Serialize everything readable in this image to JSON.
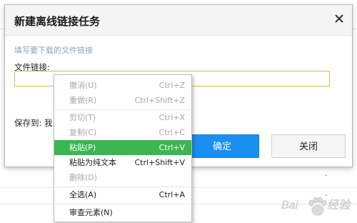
{
  "dialog": {
    "title": "新建离线链接任务",
    "close_icon": "close-icon",
    "hint": "填写要下载的文件链接",
    "link_label": "文件链接:",
    "link_value": "",
    "save_label": "保存到: 我",
    "confirm_label": "确定",
    "close_label": "关闭"
  },
  "context_menu": {
    "items": [
      {
        "label": "撤消(U)",
        "shortcut": "Ctrl+Z",
        "state": "disabled"
      },
      {
        "label": "重做(R)",
        "shortcut": "Ctrl+Shift+Z",
        "state": "disabled"
      },
      {
        "label": "剪切(T)",
        "shortcut": "Ctrl+X",
        "state": "disabled"
      },
      {
        "label": "复制(C)",
        "shortcut": "Ctrl+C",
        "state": "disabled"
      },
      {
        "label": "粘贴(P)",
        "shortcut": "Ctrl+V",
        "state": "highlighted"
      },
      {
        "label": "粘贴为纯文本",
        "shortcut": "Ctrl+Shift+V",
        "state": "enabled"
      },
      {
        "label": "删除(D)",
        "shortcut": "",
        "state": "disabled"
      },
      {
        "label": "全选(A)",
        "shortcut": "Ctrl+A",
        "state": "enabled"
      },
      {
        "label": "审查元素(N)",
        "shortcut": "",
        "state": "enabled"
      }
    ]
  },
  "watermark": {
    "icon": "baidu-paw-logo-icon",
    "text": "Baidu 经验"
  },
  "colors": {
    "primary_button": "#1a8ff0",
    "highlight": "#3cb653",
    "input_border": "#e0b64b"
  }
}
